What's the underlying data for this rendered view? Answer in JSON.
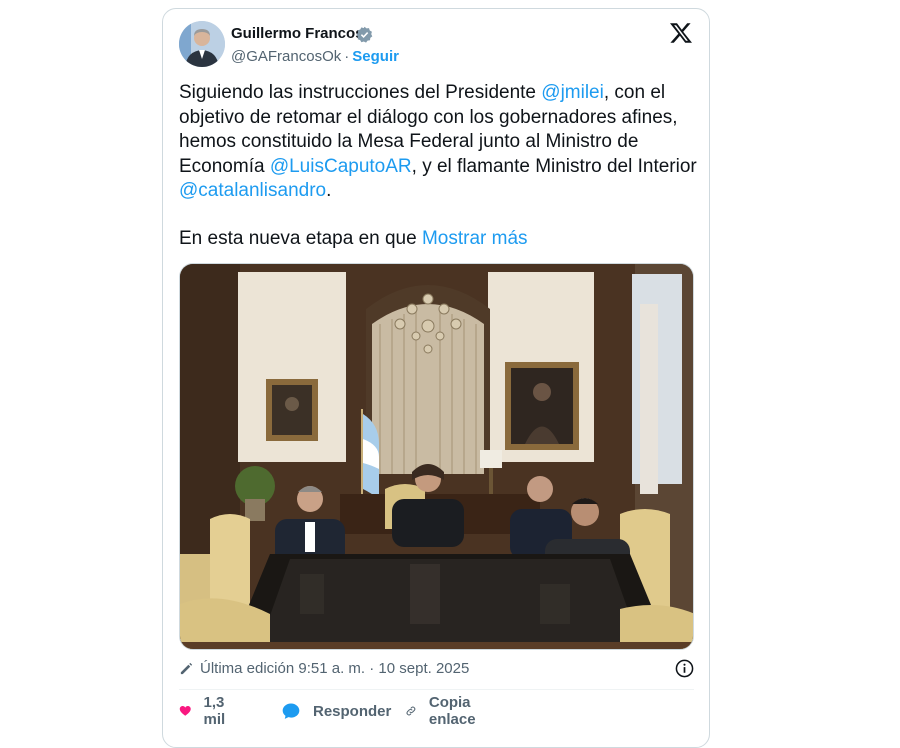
{
  "author": {
    "name": "Guillermo Francos",
    "handle": "@GAFrancosOk",
    "separator": "·",
    "follow_label": "Seguir"
  },
  "tweet": {
    "t1": "Siguiendo las instrucciones del Presidente ",
    "m1": "@jmilei",
    "t2": ", con el objetivo de retomar el diálogo con los gobernadores afines, hemos constituido la Mesa Federal junto al Ministro de Economía ",
    "m2": "@LuisCaputoAR",
    "t3": ", y el flamante Ministro del Interior ",
    "m3": "@catalanlisandro",
    "t4": ".",
    "truncated_text": "En esta nueva etapa en que ",
    "show_more": "Mostrar más"
  },
  "meta": {
    "edited": "Última edición 9:51 a. m. · 10 sept. 2025"
  },
  "actions": {
    "likes": "1,3 mil",
    "reply": "Responder",
    "copy_link": "Copia enlace"
  },
  "colors": {
    "accent": "#1d9bf0",
    "like": "#f91880",
    "text": "#0f1419",
    "muted": "#536471"
  }
}
